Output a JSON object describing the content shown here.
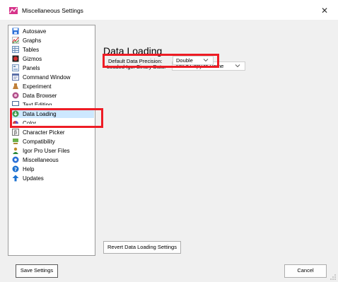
{
  "window": {
    "title": "Miscellaneous Settings",
    "close_glyph": "✕"
  },
  "sidebar": {
    "items": [
      {
        "label": "Autosave",
        "icon": "autosave-icon",
        "color": "#2a6fd6"
      },
      {
        "label": "Graphs",
        "icon": "graphs-icon",
        "color": "#3c8f3c"
      },
      {
        "label": "Tables",
        "icon": "tables-icon",
        "color": "#6b8fb8"
      },
      {
        "label": "Gizmos",
        "icon": "gizmos-icon",
        "color": "#b02020"
      },
      {
        "label": "Panels",
        "icon": "panels-icon",
        "color": "#7a9ac0"
      },
      {
        "label": "Command Window",
        "icon": "command-window-icon",
        "color": "#5b6fa8"
      },
      {
        "label": "Experiment",
        "icon": "experiment-icon",
        "color": "#c0803a"
      },
      {
        "label": "Data Browser",
        "icon": "data-browser-icon",
        "color": "#b0508a"
      },
      {
        "label": "Text Editing",
        "icon": "text-editing-icon",
        "color": "#4a6a9a"
      },
      {
        "label": "Data Loading",
        "icon": "data-loading-icon",
        "color": "#3a9a4a"
      },
      {
        "label": "Color",
        "icon": "color-icon",
        "color": "#d04040"
      },
      {
        "label": "Character Picker",
        "icon": "character-picker-icon",
        "color": "#777777"
      },
      {
        "label": "Compatibility",
        "icon": "compatibility-icon",
        "color": "#4a8a2a"
      },
      {
        "label": "Igor Pro User Files",
        "icon": "user-files-icon",
        "color": "#c08a2a"
      },
      {
        "label": "Miscellaneous",
        "icon": "miscellaneous-icon",
        "color": "#2a6fd6"
      },
      {
        "label": "Help",
        "icon": "help-icon",
        "color": "#1a6fd0"
      },
      {
        "label": "Updates",
        "icon": "updates-icon",
        "color": "#1a70d0"
      }
    ],
    "selected": "Data Loading"
  },
  "panel": {
    "title": "Data Loading",
    "loaded_label": "Loaded Igor Binary Data:",
    "loaded_value": "Ask if Copy to Home",
    "precision_label": "Default Data Precision:",
    "precision_value": "Double",
    "revert_button": "Revert Data Loading Settings"
  },
  "footer": {
    "save_button": "Save Settings",
    "cancel_button": "Cancel"
  },
  "colors": {
    "highlight": "#ee1c25",
    "selection": "#cde8ff"
  }
}
